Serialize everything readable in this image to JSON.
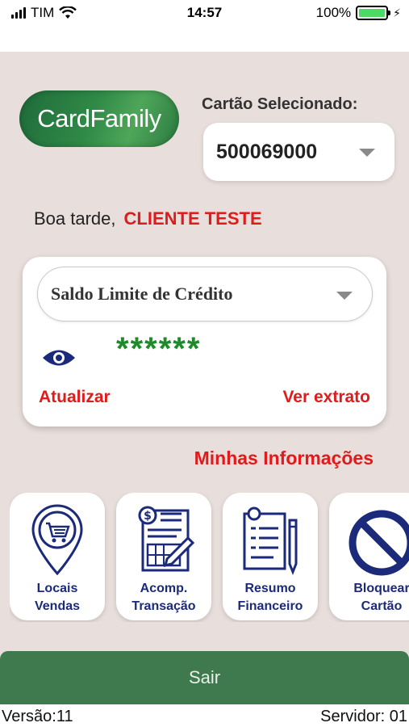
{
  "status_bar": {
    "carrier": "TIM",
    "time": "14:57",
    "battery": "100%",
    "battery_level": 1.0
  },
  "header": {
    "logo_text": "CardFamily",
    "card_label": "Cartão Selecionado:",
    "card_number": "500069000"
  },
  "greeting": {
    "salutation": "Boa tarde,",
    "client_name": "CLIENTE TESTE"
  },
  "balance": {
    "selected_option": "Saldo Limite de Crédito",
    "masked_value": "******",
    "update_label": "Atualizar",
    "statement_label": "Ver extrato"
  },
  "info": {
    "title": "Minhas Informações"
  },
  "tiles": [
    {
      "line1": "Locais",
      "line2": "Vendas",
      "icon": "store-location-icon"
    },
    {
      "line1": "Acomp.",
      "line2": "Transação",
      "icon": "transaction-report-icon"
    },
    {
      "line1": "Resumo",
      "line2": "Financeiro",
      "icon": "financial-summary-icon"
    },
    {
      "line1": "Bloquear",
      "line2": "Cartão",
      "icon": "block-icon"
    }
  ],
  "actions": {
    "logout_label": "Sair"
  },
  "footer": {
    "version": "Versão:11",
    "server": "Servidor: 01"
  },
  "colors": {
    "accent_red": "#e11b1b",
    "brand_green": "#3e7a4d",
    "icon_navy": "#1b2a7a",
    "balance_green": "#1f8a2a",
    "background": "#e8dedb"
  }
}
